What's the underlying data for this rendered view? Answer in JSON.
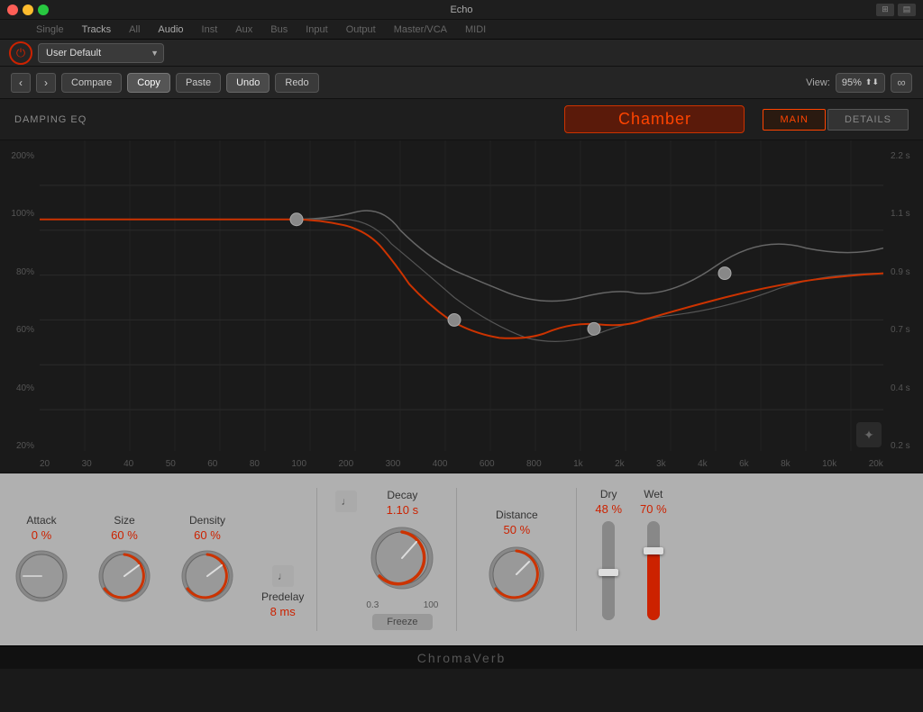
{
  "window": {
    "title": "Echo"
  },
  "topNav": {
    "items": [
      "Single",
      "Tracks",
      "All",
      "Audio",
      "Inst",
      "Aux",
      "Bus",
      "Input",
      "Output",
      "Master/VCA",
      "MIDI"
    ]
  },
  "toolbar": {
    "preset": "User Default",
    "compare_label": "Compare",
    "copy_label": "Copy",
    "paste_label": "Paste",
    "undo_label": "Undo",
    "redo_label": "Redo",
    "view_label": "View:",
    "view_pct": "95%"
  },
  "plugin": {
    "damping_label": "DAMPING EQ",
    "preset_name": "Chamber",
    "tabs": [
      "MAIN",
      "DETAILS"
    ]
  },
  "eq": {
    "y_labels": [
      "200%",
      "100%",
      "80%",
      "60%",
      "40%",
      "20%"
    ],
    "y_labels_right": [
      "2.2 s",
      "1.1 s",
      "0.9 s",
      "0.7 s",
      "0.4 s",
      "0.2 s"
    ],
    "x_labels": [
      "20",
      "30",
      "40",
      "50",
      "60",
      "80",
      "100",
      "200",
      "300",
      "400",
      "600",
      "800",
      "1k",
      "2k",
      "3k",
      "4k",
      "6k",
      "8k",
      "10k",
      "20k"
    ]
  },
  "controls": {
    "attack": {
      "label": "Attack",
      "value": "0 %",
      "knob_angle": -90
    },
    "size": {
      "label": "Size",
      "value": "60 %",
      "knob_angle": 30
    },
    "density": {
      "label": "Density",
      "value": "60 %",
      "knob_angle": 30
    },
    "predelay": {
      "label": "Predelay",
      "value": "8 ms"
    },
    "decay": {
      "label": "Decay",
      "value": "1.10 s",
      "knob_angle": 45,
      "range_min": "0.3",
      "range_max": "100"
    },
    "freeze": {
      "label": "Freeze"
    },
    "distance": {
      "label": "Distance",
      "value": "50 %",
      "knob_angle": 20
    },
    "dry": {
      "label": "Dry",
      "value": "48 %",
      "fill_pct": 48
    },
    "wet": {
      "label": "Wet",
      "value": "70 %",
      "fill_pct": 70
    }
  },
  "brand": {
    "name": "ChromaVerb"
  }
}
